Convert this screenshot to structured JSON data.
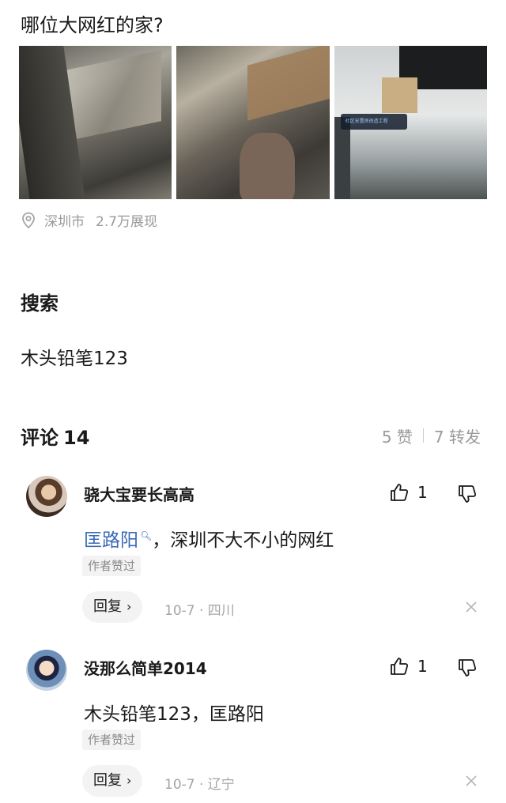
{
  "post": {
    "title": "哪位大网红的家?",
    "location": "深圳市",
    "views": "2.7万展现",
    "photo_overlay_text": "社区安置房改造工程"
  },
  "search_section": {
    "label": "搜索",
    "term": "木头铅笔123"
  },
  "comments_header": {
    "title": "评论",
    "count": "14",
    "likes": "5 赞",
    "reposts": "7 转发"
  },
  "comments": [
    {
      "username": "骁大宝要长高高",
      "likes": "1",
      "mention": "匡路阳",
      "text": "，深圳不大不小的网红",
      "badge": "作者赞过",
      "reply_label": "回复",
      "meta": "10-7 · 四川"
    },
    {
      "username": "没那么简单2014",
      "likes": "1",
      "text": "木头铅笔123，匡路阳",
      "badge": "作者赞过",
      "reply_label": "回复",
      "meta": "10-7 · 辽宁"
    }
  ],
  "icons": {
    "location": "location-pin-icon",
    "like": "thumbs-up-icon",
    "dislike": "thumbs-down-icon",
    "close": "close-icon",
    "chevron": "chevron-right-icon",
    "search_mention": "search-icon"
  },
  "colors": {
    "mention": "#3a6ab8",
    "muted": "#9a9a9a",
    "badge_bg": "#f3f3f3"
  }
}
